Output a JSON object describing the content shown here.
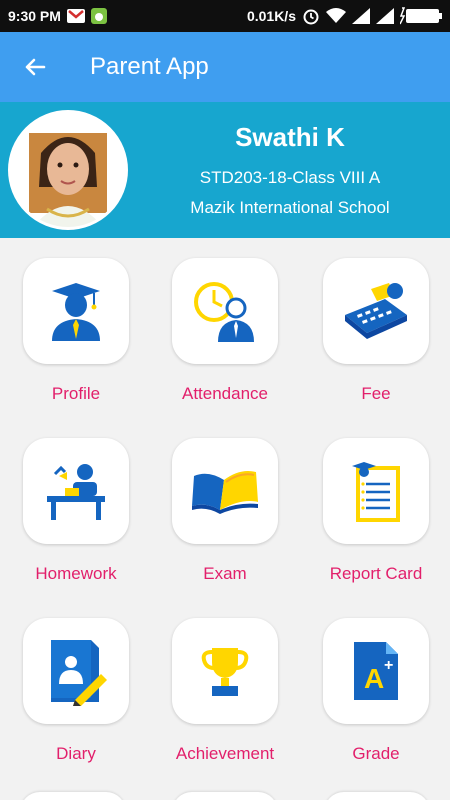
{
  "status_bar": {
    "time": "9:30 PM",
    "net_speed": "0.01K/s",
    "icons": [
      "gmail-icon",
      "android-notification-icon",
      "alarm-icon",
      "wifi-icon",
      "signal-icon",
      "signal-icon-2",
      "battery-icon"
    ]
  },
  "app_bar": {
    "title": "Parent App",
    "back_icon": "arrow-left-icon"
  },
  "profile": {
    "name": "Swathi K",
    "class_line": "STD203-18-Class VIII A",
    "school": "Mazik International School"
  },
  "menu": [
    {
      "label": "Profile",
      "icon": "graduate-icon"
    },
    {
      "label": "Attendance",
      "icon": "clock-person-icon"
    },
    {
      "label": "Fee",
      "icon": "calculator-icon"
    },
    {
      "label": "Homework",
      "icon": "student-desk-icon"
    },
    {
      "label": "Exam",
      "icon": "open-book-icon"
    },
    {
      "label": "Report Card",
      "icon": "report-card-icon"
    },
    {
      "label": "Diary",
      "icon": "diary-pencil-icon"
    },
    {
      "label": "Achievement",
      "icon": "trophy-icon"
    },
    {
      "label": "Grade",
      "icon": "grade-a-plus-icon"
    }
  ],
  "colors": {
    "app_bar": "#3f9ef0",
    "profile_bg": "#17a6cf",
    "label": "#e21f6b",
    "icon_blue": "#1565c0",
    "icon_yellow": "#ffd600"
  }
}
